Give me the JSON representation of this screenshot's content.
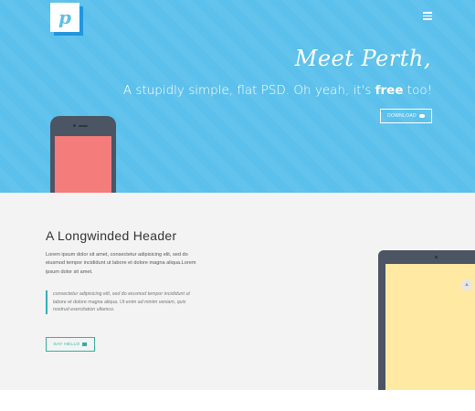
{
  "header": {
    "logo_letter": "p",
    "menu_icon": "hamburger-menu-icon"
  },
  "hero": {
    "title": "Meet Perth,",
    "subtitle_before": "A stupidly simple, flat PSD. Oh yeah, it's ",
    "subtitle_bold": "free",
    "subtitle_after": " too!",
    "download_label": "DOWNLOAD",
    "download_icon": "cloud-download-icon",
    "background_color": "#5bc0eb",
    "phone_screen_color": "#f47c7a"
  },
  "content": {
    "header": "A Longwinded Header",
    "paragraph": "Lorem ipsum dolor sit amet, consectetur adipisicing elit, sed do eiusmod tempor incididunt ut labore et dolore magna aliqua.Lorem ipsum dolor sit amet.",
    "quote": "consectetur adipisicing elit, sed do eiusmod tempor incididunt ut labore et dolore magna aliqua. Ut enim ad minim veniam, quis nostrud exercitation ullamco.",
    "button_label": "SAY HELLO",
    "button_icon": "mail-icon",
    "accent_color": "#2bb3a0",
    "tablet_screen_color": "#ffe9a3",
    "scroll_icon": "chevron-up-icon"
  }
}
